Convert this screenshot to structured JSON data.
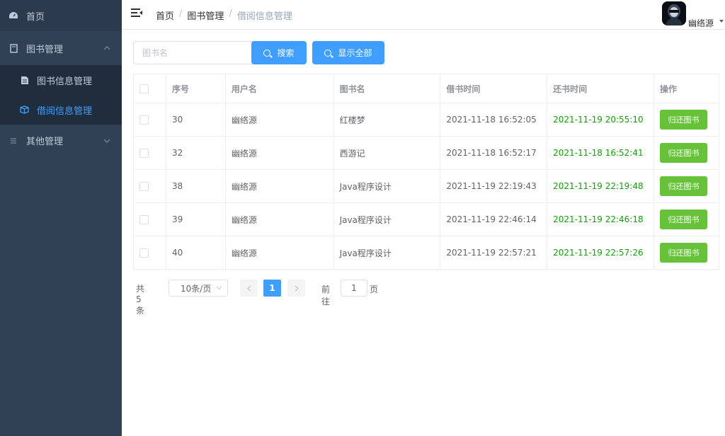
{
  "sidebar": {
    "home": "首页",
    "book_mgmt": "图书管理",
    "book_info": "图书信息管理",
    "borrow_info": "借阅信息管理",
    "other_mgmt": "其他管理"
  },
  "header": {
    "breadcrumb": [
      "首页",
      "图书管理",
      "借阅信息管理"
    ],
    "user_name": "幽络源"
  },
  "toolbar": {
    "search_placeholder": "图书名",
    "search_label": "搜索",
    "show_all_label": "显示全部"
  },
  "table": {
    "columns": [
      "序号",
      "用户名",
      "图书名",
      "借书时间",
      "还书时间",
      "操作"
    ],
    "rows": [
      {
        "id": "30",
        "user": "幽络源",
        "book": "红楼梦",
        "borrow": "2021-11-18 16:52:05",
        "return": "2021-11-19 20:55:10",
        "action": "归还图书"
      },
      {
        "id": "32",
        "user": "幽络源",
        "book": "西游记",
        "borrow": "2021-11-18 16:52:17",
        "return": "2021-11-18 16:52:41",
        "action": "归还图书"
      },
      {
        "id": "38",
        "user": "幽络源",
        "book": "Java程序设计",
        "borrow": "2021-11-19 22:19:43",
        "return": "2021-11-19 22:19:48",
        "action": "归还图书"
      },
      {
        "id": "39",
        "user": "幽络源",
        "book": "Java程序设计",
        "borrow": "2021-11-19 22:46:14",
        "return": "2021-11-19 22:46:18",
        "action": "归还图书"
      },
      {
        "id": "40",
        "user": "幽络源",
        "book": "Java程序设计",
        "borrow": "2021-11-19 22:57:21",
        "return": "2021-11-19 22:57:26",
        "action": "归还图书"
      }
    ]
  },
  "pagination": {
    "total": "共 5 条",
    "page_size": "10条/页",
    "current_page": "1",
    "goto_label": "前往",
    "goto_value": "1",
    "goto_unit": "页"
  },
  "colors": {
    "sidebar_bg": "#304156",
    "primary": "#409eff",
    "success": "#67c23a",
    "return_time": "#13a00a"
  }
}
